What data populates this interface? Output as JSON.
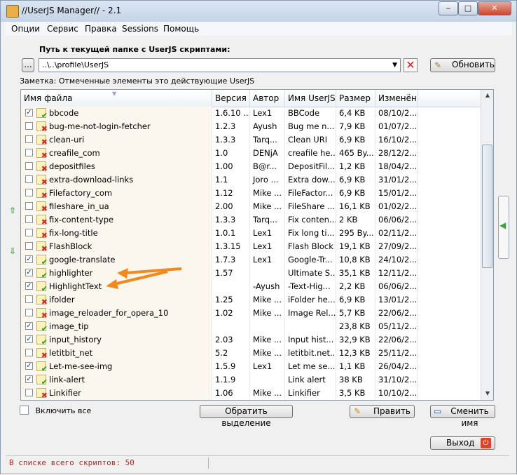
{
  "window": {
    "title": "//UserJS Manager// - 2.1"
  },
  "menu": [
    "Опции",
    "Сервис",
    "Правка",
    "Sessions",
    "Помощь"
  ],
  "path": {
    "label": "Путь к текущей папке с UserJS скриптами:",
    "browse_label": "...",
    "value": "..\\..\\profile\\UserJS",
    "refresh_label": "Обновить"
  },
  "note": "Заметка: Отмеченные элементы это действующие UserJS",
  "columns": [
    "Имя файла",
    "Версия",
    "Автор",
    "Имя UserJS",
    "Размер",
    "Изменён"
  ],
  "rows": [
    {
      "checked": true,
      "ok": true,
      "name": "bbcode",
      "version": "1.6.10 ...",
      "author": "Lex1",
      "js": "BBCode",
      "size": "6,4 KB",
      "date": "08/10/2..."
    },
    {
      "checked": false,
      "ok": false,
      "name": "bug-me-not-login-fetcher",
      "version": "1.2.3",
      "author": "Ayush",
      "js": "Bug me n...",
      "size": "7,9 KB",
      "date": "01/07/2..."
    },
    {
      "checked": false,
      "ok": false,
      "name": "clean-uri",
      "version": "1.3.3",
      "author": "Tarq...",
      "js": "Clean URI",
      "size": "6,9 KB",
      "date": "16/10/2..."
    },
    {
      "checked": false,
      "ok": false,
      "name": "creafile_com",
      "version": "1.0",
      "author": "DENjA",
      "js": "creafile he...",
      "size": "465 By...",
      "date": "28/12/2..."
    },
    {
      "checked": false,
      "ok": false,
      "name": "depositfiles",
      "version": "1.00",
      "author": "B@r...",
      "js": "DepositFil...",
      "size": "1,2 KB",
      "date": "18/04/2..."
    },
    {
      "checked": false,
      "ok": false,
      "name": "extra-download-links",
      "version": "1.1",
      "author": "Joro ...",
      "js": "Extra dow...",
      "size": "6,9 KB",
      "date": "31/01/2..."
    },
    {
      "checked": false,
      "ok": false,
      "name": "Filefactory_com",
      "version": "1.12",
      "author": "Mike ...",
      "js": "FileFactor...",
      "size": "6,9 KB",
      "date": "15/01/2..."
    },
    {
      "checked": false,
      "ok": false,
      "name": "fileshare_in_ua",
      "version": "2.00",
      "author": "Mike ...",
      "js": "FileShare ...",
      "size": "16,1 KB",
      "date": "01/02/2..."
    },
    {
      "checked": false,
      "ok": false,
      "name": "fix-content-type",
      "version": "1.3.3",
      "author": "Tarq...",
      "js": "Fix conten...",
      "size": "2 KB",
      "date": "06/06/2..."
    },
    {
      "checked": false,
      "ok": false,
      "name": "fix-long-title",
      "version": "1.0.1",
      "author": "Lex1",
      "js": "Fix long ti...",
      "size": "295 By...",
      "date": "02/11/2..."
    },
    {
      "checked": false,
      "ok": false,
      "name": "FlashBlock",
      "version": "1.3.15",
      "author": "Lex1",
      "js": "Flash Block",
      "size": "19,1 KB",
      "date": "27/09/2..."
    },
    {
      "checked": true,
      "ok": true,
      "name": "google-translate",
      "version": "1.7.3",
      "author": "Lex1",
      "js": "Google-Tr...",
      "size": "10,8 KB",
      "date": "24/10/2..."
    },
    {
      "checked": true,
      "ok": true,
      "name": "highlighter",
      "version": "1.57",
      "author": "",
      "js": "Ultimate S...",
      "size": "35,1 KB",
      "date": "12/11/2..."
    },
    {
      "checked": true,
      "ok": true,
      "name": "HighlightText",
      "version": "",
      "author": "-Ayush",
      "js": "-Text-Hig...",
      "size": "2,2 KB",
      "date": "06/06/2..."
    },
    {
      "checked": false,
      "ok": false,
      "name": "ifolder",
      "version": "1.25",
      "author": "Mike ...",
      "js": "iFolder he...",
      "size": "6,9 KB",
      "date": "13/01/2..."
    },
    {
      "checked": false,
      "ok": false,
      "name": "image_reloader_for_opera_10",
      "version": "1.02",
      "author": "Mike ...",
      "js": "Image Rel...",
      "size": "5,7 KB",
      "date": "22/06/2..."
    },
    {
      "checked": true,
      "ok": true,
      "name": "image_tip",
      "version": "",
      "author": "",
      "js": "",
      "size": "23,8 KB",
      "date": "05/11/2..."
    },
    {
      "checked": true,
      "ok": true,
      "name": "input_history",
      "version": "2.03",
      "author": "Mike ...",
      "js": "Input hist...",
      "size": "32,9 KB",
      "date": "22/06/2..."
    },
    {
      "checked": false,
      "ok": false,
      "name": "letitbit_net",
      "version": "5.2",
      "author": "Mike ...",
      "js": "letitbit.net...",
      "size": "12,3 KB",
      "date": "25/11/2..."
    },
    {
      "checked": true,
      "ok": true,
      "name": "Let-me-see-img",
      "version": "1.5.9",
      "author": "Lex1",
      "js": "Let me se...",
      "size": "1,1 KB",
      "date": "26/04/2..."
    },
    {
      "checked": true,
      "ok": true,
      "name": "link-alert",
      "version": "1.1.9",
      "author": "",
      "js": "Link alert",
      "size": "38 KB",
      "date": "31/10/2..."
    },
    {
      "checked": false,
      "ok": false,
      "name": "Linkifier",
      "version": "1.06",
      "author": "Mike ...",
      "js": "Linkifier",
      "size": "3,5 KB",
      "date": "10/10/2..."
    }
  ],
  "footer": {
    "select_all": "Включить все",
    "invert": "Обратить выделение",
    "edit": "Править",
    "rename": "Сменить имя",
    "exit": "Выход"
  },
  "status": {
    "text": "В списке всего скриптов: 50"
  },
  "colors": {
    "accent_arrow": "#f08a1e",
    "ok": "#1c9e22",
    "err": "#d62828"
  }
}
